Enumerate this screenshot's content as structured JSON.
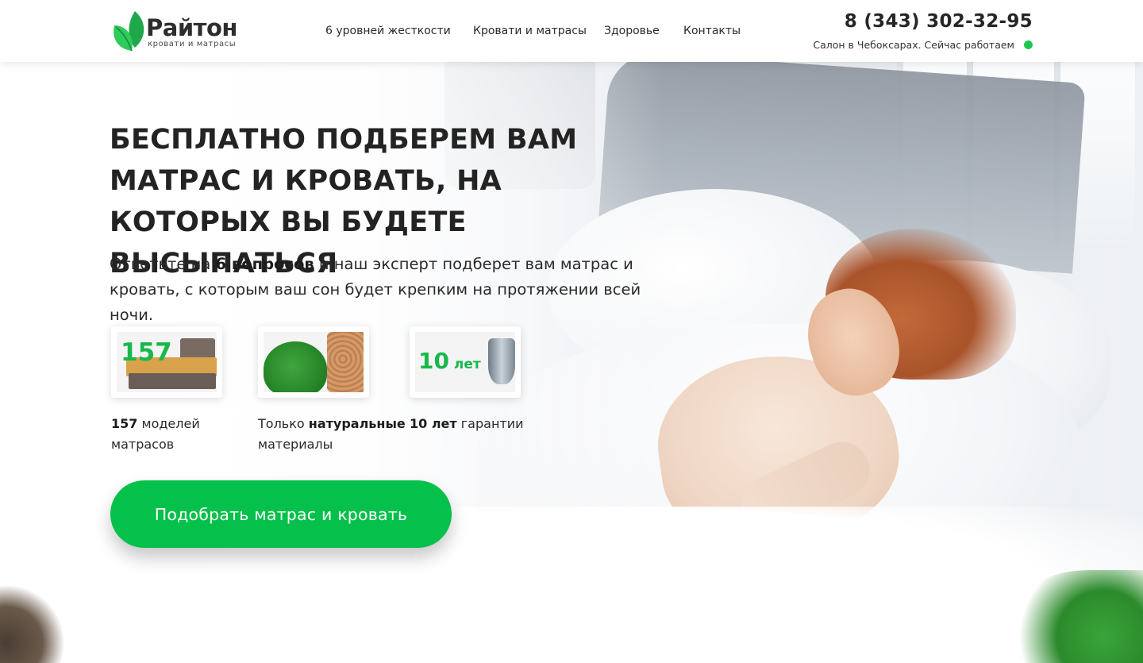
{
  "header": {
    "logo_title": "Райтон",
    "logo_subtitle": "кровати и матрасы",
    "nav": [
      "6 уровней жесткости",
      "Кровати и матрасы",
      "Здоровье",
      "Контакты"
    ],
    "phone": "8 (343) 302-32-95",
    "salon_status": "Салон в Чебоксарах. Сейчас работаем",
    "status_color": "#1fc74e"
  },
  "hero": {
    "headline": "Бесплатно подберем вам матрас и кровать, на которых вы будете высыпаться",
    "lead_part1": "Ответьте на ",
    "lead_bold": "6 вопросов",
    "lead_part2": " и наш эксперт подберет вам матрас и кровать, с которым ваш сон будет крепким на протяжении всей ночи.",
    "features": [
      {
        "image_label": "157",
        "bold": "157",
        "text": " моделей матрасов",
        "icon": "bed-icon"
      },
      {
        "pre": "Только ",
        "bold": "натуральные",
        "text": " материалы",
        "icon": "tree-wood-icon"
      },
      {
        "image_label_num": "10",
        "image_label_unit": " лет",
        "bold": "10 лет",
        "text": " гарантии",
        "icon": "shield-icon"
      }
    ],
    "cta_label": "Подобрать матрас и кровать"
  },
  "colors": {
    "accent": "#05c04a",
    "text": "#232323"
  }
}
